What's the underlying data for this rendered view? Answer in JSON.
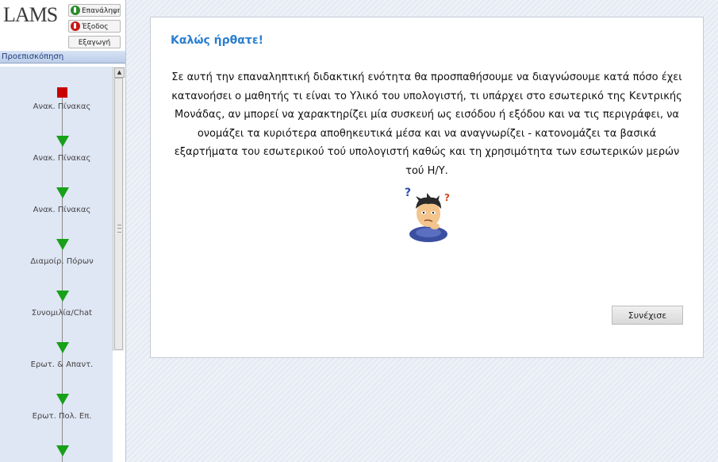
{
  "app": {
    "logo_text": "LAMS"
  },
  "toolbar": {
    "restart_label": "Επανάληψη",
    "exit_label": "Έξοδος",
    "export_label": "Εξαγωγή"
  },
  "sidebar": {
    "preview_label": "Προεπισκόπηση",
    "activities": [
      {
        "label": "Ανακ. Πίνακας",
        "marker": "current-square"
      },
      {
        "label": "Ανακ. Πίνακας",
        "marker": "arrow-down"
      },
      {
        "label": "Ανακ. Πίνακας",
        "marker": "arrow-down"
      },
      {
        "label": "Διαμοίρ. Πόρων",
        "marker": "arrow-down"
      },
      {
        "label": "Συνομιλία/Chat",
        "marker": "arrow-down"
      },
      {
        "label": "Ερωτ. & Απαντ.",
        "marker": "arrow-down"
      },
      {
        "label": "Ερωτ. Πολ. Επ.",
        "marker": "arrow-down"
      }
    ]
  },
  "content": {
    "title": "Καλώς ήρθατε!",
    "description": "Σε αυτή την επαναληπτική διδακτική ενότητα θα προσπαθήσουμε να διαγνώσουμε κατά πόσο έχει κατανοήσει ο μαθητής τι είναι το Υλικό του υπολογιστή, τι υπάρχει στο εσωτερικό της Κεντρικής Μονάδας, αν μπορεί να χαρακτηρίζει μία συσκευή ως εισόδου ή εξόδου και να τις περιγράφει, να ονομάζει τα κυριότερα αποθηκευτικά μέσα και να αναγνωρίζει - κατονομάζει τα βασικά εξαρτήματα του εσωτερικού τού υπολογιστή καθώς και τη χρησιμότητα των εσωτερικών μερών τού Η/Υ.",
    "continue_label": "Συνέχισε"
  },
  "colors": {
    "title": "#2b7fd0",
    "current_marker": "#c80000",
    "arrow_marker": "#18a018",
    "exit_icon": "#c81818",
    "restart_icon": "#2b8a2b"
  },
  "icons": {
    "thinker": "thinking-boy-icon",
    "restart": "restart-icon",
    "exit": "exit-icon"
  }
}
